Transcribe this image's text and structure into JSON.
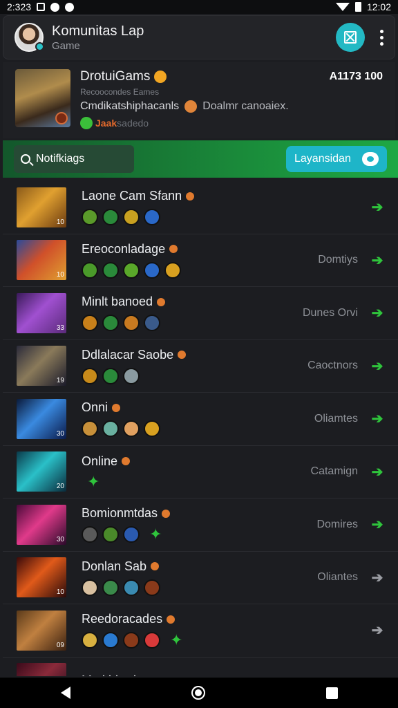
{
  "status_bar": {
    "time": "2:323",
    "clock": "12:02"
  },
  "header": {
    "title": "Komunitas Lap",
    "subtitle": "Game",
    "accent": "#23b9c4"
  },
  "featured": {
    "title": "DrotuiGams",
    "count": "A1173 100",
    "subtitle": "Recoocondes Eames",
    "desc_left": "Cmdikatshiphacanls",
    "desc_right": "Doalmr canoaiex.",
    "tag_orange": "Jaak",
    "tag_rest": "sadedo"
  },
  "search": {
    "placeholder": "Notifkiags",
    "button_label": "Layansidan",
    "accent_green": "#1a8a3a"
  },
  "list": [
    {
      "title": "Laone Cam Sfann",
      "status": "",
      "level": "10",
      "avatars": [
        "#5a9a2a",
        "#2a8a3a",
        "#c8a020",
        "#2a68c8"
      ],
      "spark": false,
      "arrow_green": true,
      "thumb": "linear-gradient(135deg,#8a5a1a,#e0a030 45%,#6a3a10)"
    },
    {
      "title": "Ereoconladage",
      "status": "Domtiys",
      "level": "10",
      "avatars": [
        "#4a9a2a",
        "#2a8a3a",
        "#5aa82a",
        "#2a68c8",
        "#d8a020"
      ],
      "spark": false,
      "arrow_green": true,
      "thumb": "linear-gradient(135deg,#2a4a9a,#d0502a 45%,#e0a030)"
    },
    {
      "title": "Minlt banoed",
      "status": "Dunes Orvi",
      "level": "33",
      "avatars": [
        "#c8801a",
        "#2a8a3a",
        "#c87a20",
        "#3a5a8a"
      ],
      "spark": false,
      "arrow_green": true,
      "thumb": "linear-gradient(135deg,#3a1a5a,#a050d0 45%,#5a2a7a)"
    },
    {
      "title": "Ddlalacar Saobe",
      "status": "Caoctnors",
      "level": "19",
      "avatars": [
        "#c88a1a",
        "#2a8a3a",
        "#8a9aa0"
      ],
      "spark": false,
      "arrow_green": true,
      "thumb": "linear-gradient(135deg,#2a2a3a,#8a7a5a 45%,#1a1a2a)"
    },
    {
      "title": "Onni",
      "status": "Oliamtes",
      "level": "30",
      "avatars": [
        "#c8903a",
        "#6ab0a0",
        "#e0a060",
        "#d8a020"
      ],
      "spark": false,
      "arrow_green": true,
      "thumb": "linear-gradient(135deg,#0a1a3a,#3a8ae0 45%,#0a1a4a)"
    },
    {
      "title": "Online",
      "status": "Catamign",
      "level": "20",
      "avatars": [],
      "spark": true,
      "arrow_green": true,
      "thumb": "linear-gradient(135deg,#0a3a4a,#2ac0c8 45%,#0a2a3a)"
    },
    {
      "title": "Bomionmtdas",
      "status": "Domires",
      "level": "30",
      "avatars": [
        "#5a5a5a",
        "#4a8a2a",
        "#2a5ab0"
      ],
      "spark": true,
      "arrow_green": true,
      "thumb": "linear-gradient(135deg,#4a0a3a,#e03a8a 45%,#2a0a2a)"
    },
    {
      "title": "Donlan Sab",
      "status": "Oliantes",
      "level": "10",
      "avatars": [
        "#d8c0a0",
        "#3a8a4a",
        "#3a8ab0",
        "#8a3a1a"
      ],
      "spark": false,
      "arrow_green": false,
      "thumb": "linear-gradient(135deg,#3a0a0a,#e05a1a 45%,#2a0a0a)"
    },
    {
      "title": "Reedoracades",
      "status": "",
      "level": "09",
      "avatars": [
        "#d8b040",
        "#2a7ad0",
        "#8a3a1a",
        "#d83a3a"
      ],
      "spark": true,
      "arrow_green": false,
      "thumb": "linear-gradient(135deg,#5a3a1a,#c08040 45%,#3a2010)"
    },
    {
      "title": "Mmkidrad ..",
      "status": "",
      "level": "",
      "avatars": [],
      "spark": false,
      "arrow_green": false,
      "thumb": "linear-gradient(135deg,#3a0a1a,#8a2a3a 45%,#1a0a1a)"
    }
  ]
}
